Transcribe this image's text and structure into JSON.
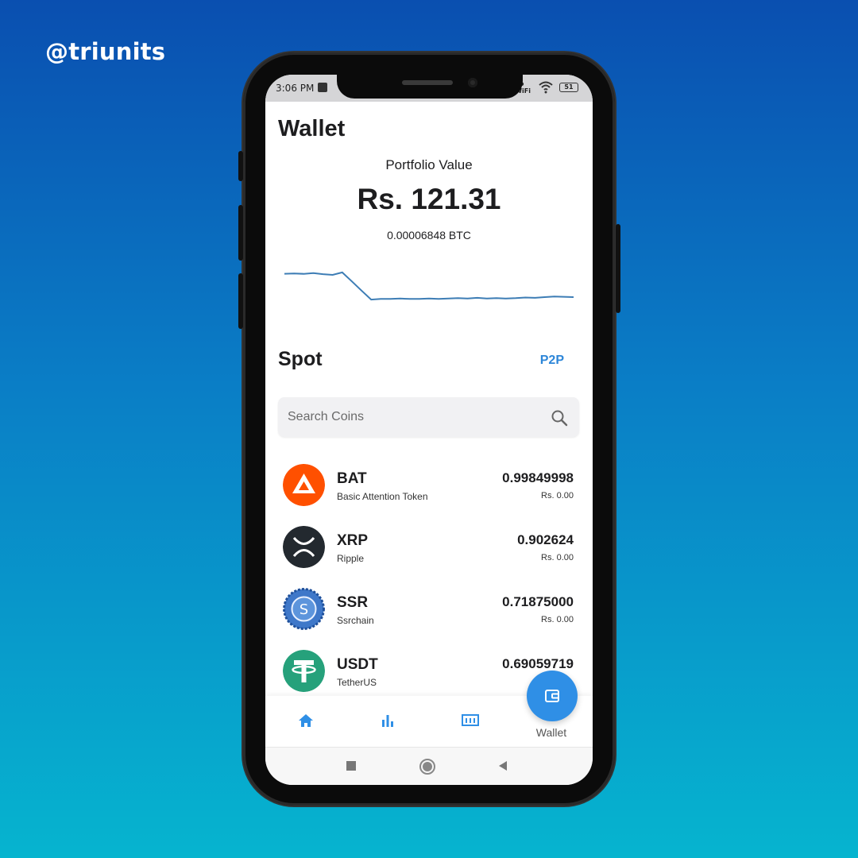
{
  "brand": "@triunits",
  "status": {
    "time": "3:06 PM",
    "network": "Vo\nWiFi",
    "battery": "51"
  },
  "header": {
    "title": "Wallet"
  },
  "portfolio": {
    "label": "Portfolio Value",
    "value": "Rs. 121.31",
    "btc": "0.00006848 BTC",
    "line_color": "#3d7db5"
  },
  "chart_data": {
    "type": "line",
    "x": [
      0,
      1,
      2,
      3,
      4,
      5,
      6,
      7,
      8,
      9,
      10,
      11,
      12,
      13,
      14,
      15,
      16,
      17,
      18,
      19,
      20,
      21,
      22,
      23,
      24,
      25,
      26,
      27,
      28,
      29,
      30
    ],
    "series": [
      {
        "values": [
          36.2,
          36.3,
          36.2,
          36.4,
          36.1,
          35.9,
          36.6,
          34.0,
          31.3,
          28.7,
          28.9,
          28.9,
          29.0,
          28.9,
          28.9,
          29.0,
          28.9,
          29.0,
          29.1,
          29.0,
          29.2,
          29.0,
          29.1,
          29.0,
          29.1,
          29.3,
          29.2,
          29.4,
          29.6,
          29.5,
          29.4
        ]
      }
    ]
  },
  "spot": {
    "title": "Spot",
    "p2p_label": "P2P"
  },
  "search": {
    "placeholder": "Search Coins"
  },
  "coins": [
    {
      "symbol": "BAT",
      "name": "Basic Attention Token",
      "amount": "0.99849998",
      "value": "Rs. 0.00",
      "color": "#ff5000"
    },
    {
      "symbol": "XRP",
      "name": "Ripple",
      "amount": "0.902624",
      "value": "Rs. 0.00",
      "color": "#23292f"
    },
    {
      "symbol": "SSR",
      "name": "Ssrchain",
      "amount": "0.71875000",
      "value": "Rs. 0.00",
      "color": "#2a66b8"
    },
    {
      "symbol": "USDT",
      "name": "TetherUS",
      "amount": "0.69059719",
      "value": "",
      "color": "#26a17b"
    }
  ],
  "nav": {
    "items": [
      "home-icon",
      "bar-chart-icon",
      "ticker-icon",
      "wallet-icon"
    ],
    "active_label": "Wallet",
    "accent": "#2f8fe6"
  }
}
